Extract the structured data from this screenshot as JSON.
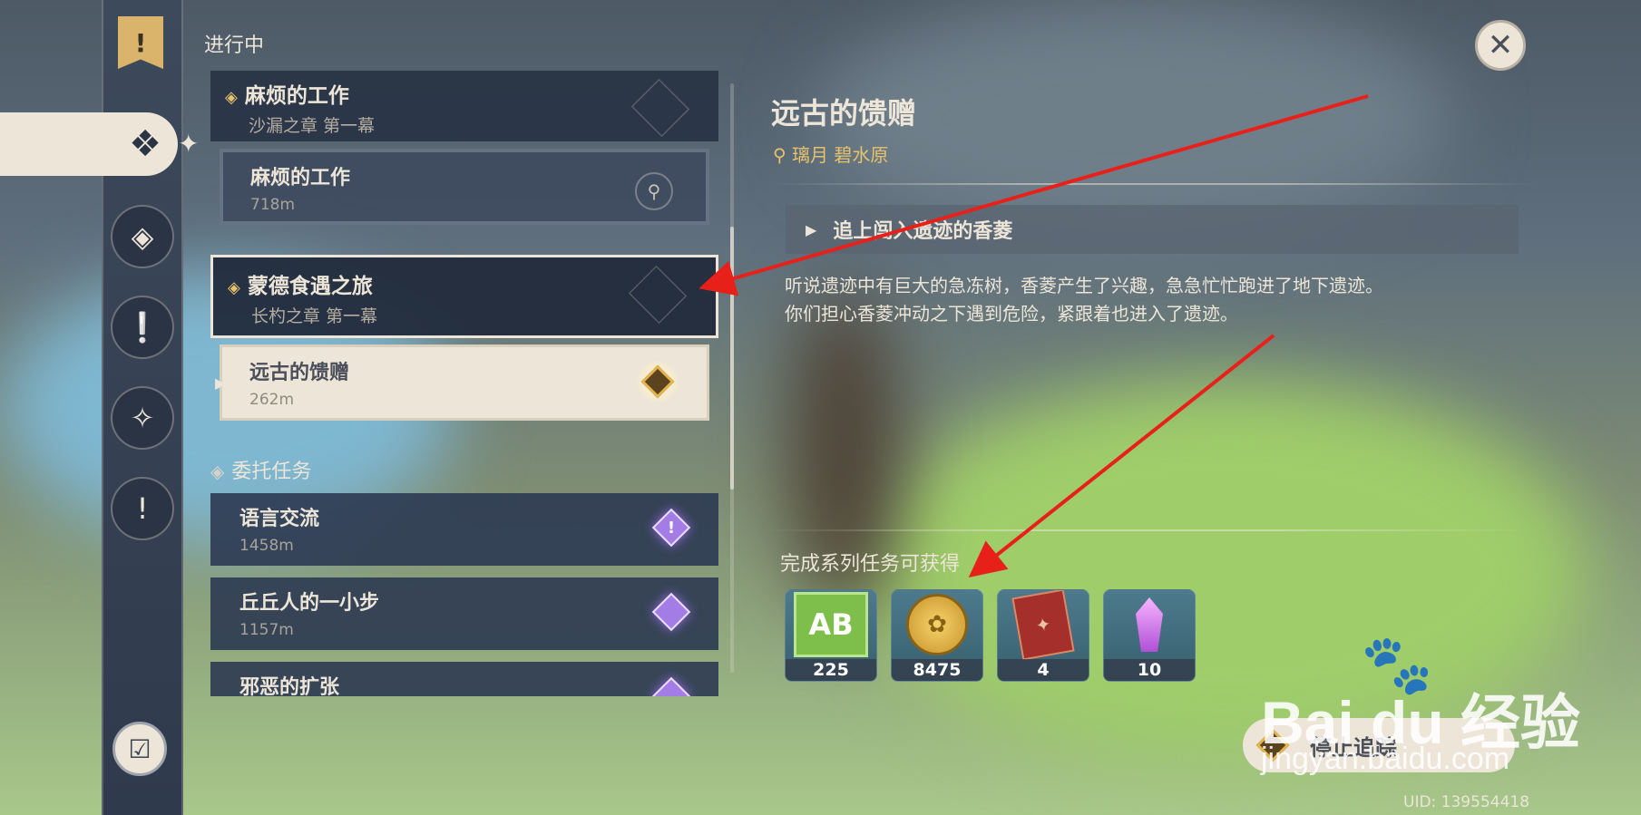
{
  "header": {
    "section_label": "进行中"
  },
  "nav": {
    "items": [
      "banner-icon",
      "quest-all-icon",
      "archon-icon",
      "story-icon",
      "world-icon",
      "commission-icon"
    ],
    "active": "quest-all-icon"
  },
  "quests": {
    "chapters": [
      {
        "title": "麻烦的工作",
        "subtitle": "沙漏之章 第一幕",
        "sub": {
          "name": "麻烦的工作",
          "distance": "718m"
        }
      },
      {
        "title": "蒙德食遇之旅",
        "subtitle": "长杓之章 第一幕",
        "sub": {
          "name": "远古的馈赠",
          "distance": "262m"
        }
      }
    ],
    "commission_header": "委托任务",
    "commissions": [
      {
        "name": "语言交流",
        "distance": "1458m"
      },
      {
        "name": "丘丘人的一小步",
        "distance": "1157m"
      },
      {
        "name": "邪恶的扩张",
        "distance": ""
      }
    ]
  },
  "detail": {
    "title": "远古的馈赠",
    "location": "璃月 碧水原",
    "step": "追上闯入遗迹的香菱",
    "description_line1": "听说遗迹中有巨大的急冻树，香菱产生了兴趣，急急忙忙跑进了地下遗迹。",
    "description_line2": "你们担心香菱冲动之下遇到危险，紧跟着也进入了遗迹。",
    "reward_header": "完成系列任务可获得",
    "rewards": [
      {
        "icon": "adventure-exp-icon",
        "count": "225"
      },
      {
        "icon": "mora-coin-icon",
        "count": "8475"
      },
      {
        "icon": "hero-wit-book-icon",
        "count": "4"
      },
      {
        "icon": "crystal-icon",
        "count": "10"
      }
    ],
    "stop_tracking": "停止追踪"
  },
  "uid": "UID: 139554418",
  "watermark": {
    "brand": "Bai du 经验",
    "url": "jingyan.baidu.com"
  },
  "colors": {
    "accent_gold": "#e6c26d",
    "cream": "#ece5d8",
    "panel": "#263042",
    "annotation_red": "#e8201a"
  }
}
